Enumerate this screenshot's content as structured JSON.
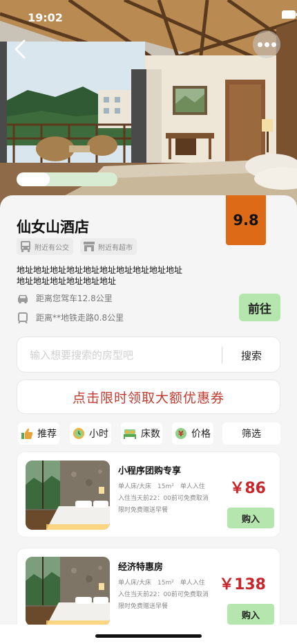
{
  "status_bar": {
    "time": "19:02"
  },
  "hotel": {
    "name": "仙女山酒店",
    "score": "9.8",
    "tags": [
      "附近有公交",
      "附近有超市"
    ],
    "address": "地址地址地址地址地址地址地址地址地址地址地址地址地址地址地址地址",
    "distances": [
      "距离您驾车12.8公里",
      "距离**地铁走路0.8公里"
    ],
    "go_label": "前往",
    "image_progress": 0.33
  },
  "search": {
    "placeholder": "输入想要搜索的房型吧",
    "button_label": "搜索"
  },
  "coupon": {
    "label": "点击限时领取大额优惠券"
  },
  "filters": [
    {
      "label": "推荐",
      "icon": "thumbs-up-icon"
    },
    {
      "label": "小时",
      "icon": "clock-icon"
    },
    {
      "label": "床数",
      "icon": "bed-icon"
    },
    {
      "label": "价格",
      "icon": "yen-icon"
    },
    {
      "label": "筛选",
      "icon": ""
    }
  ],
  "rooms": [
    {
      "name": "小程序团购专享",
      "desc": [
        "单人床/大床　15m²　单人入住",
        "入住当天前22：00前可免费取消",
        "限时免费赠送早餐"
      ],
      "price": "￥86",
      "buy_label": "购入"
    },
    {
      "name": "经济特惠房",
      "desc": [
        "单人床/大床　15m²　单人入住",
        "入住当天前22：00前可免费取消",
        "限时免费赠送早餐"
      ],
      "price": "￥138",
      "buy_label": "购入"
    }
  ],
  "colors": {
    "accent_green": "#b5e6ae",
    "score_orange": "#dc6a16",
    "price_red": "#c8262b",
    "coupon_red": "#c23a2e"
  }
}
